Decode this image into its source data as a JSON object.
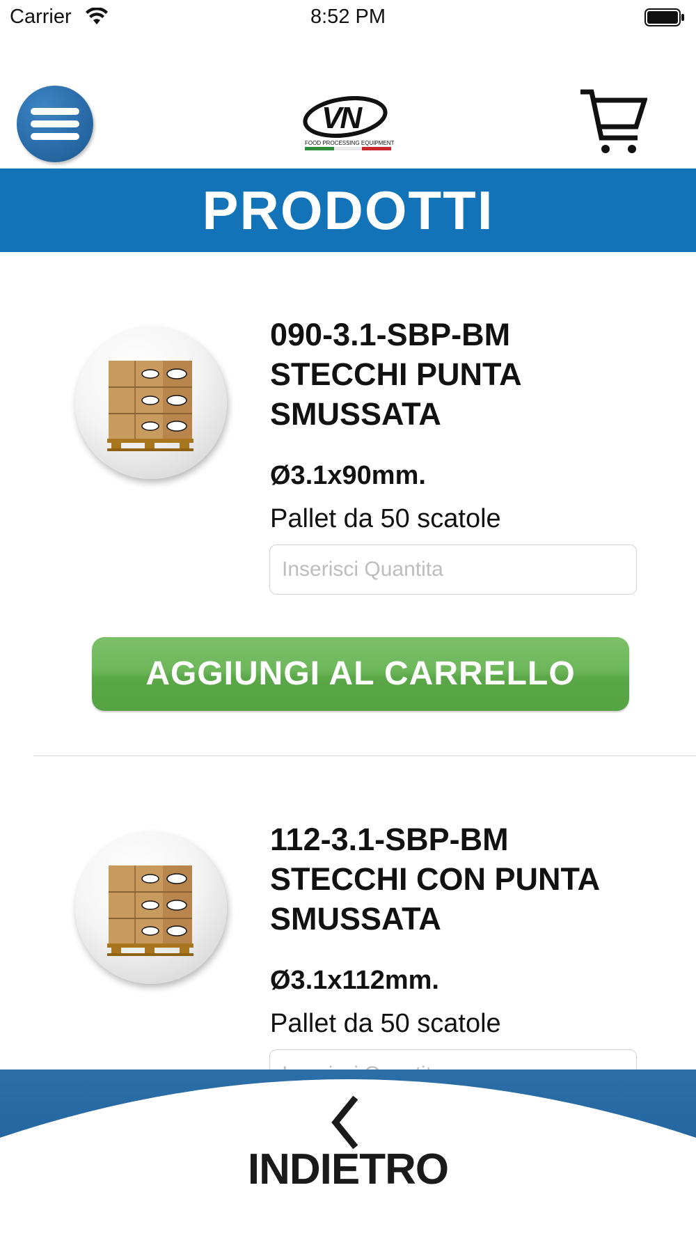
{
  "status_bar": {
    "carrier": "Carrier",
    "time": "8:52 PM"
  },
  "header": {
    "logo_text": "VN",
    "logo_subtitle": "FOOD PROCESSING EQUIPMENT",
    "menu_icon": "hamburger-menu-icon",
    "cart_icon": "shopping-cart-icon"
  },
  "page_title": "PRODOTTI",
  "products": [
    {
      "code_line1": "090-3.1-SBP-BM",
      "code_line2": "STECCHI PUNTA",
      "code_line3": "SMUSSATA",
      "spec": "Ø3.1x90mm.",
      "pack": "Pallet da 50 scatole",
      "quantity_value": "",
      "quantity_placeholder": "Inserisci Quantita",
      "add_button_label": "AGGIUNGI AL CARRELLO"
    },
    {
      "code_line1": "112-3.1-SBP-BM",
      "code_line2": "STECCHI CON PUNTA",
      "code_line3": "SMUSSATA",
      "spec": "Ø3.1x112mm.",
      "pack": "Pallet da 50 scatole",
      "quantity_value": "",
      "quantity_placeholder": "Inserisci Quantita"
    }
  ],
  "footer": {
    "back_label": "INDIETRO",
    "back_icon": "chevron-left-icon"
  },
  "colors": {
    "brand_blue": "#1273b8",
    "button_green": "#5aa748",
    "menu_blue": "#2a6ca9"
  }
}
